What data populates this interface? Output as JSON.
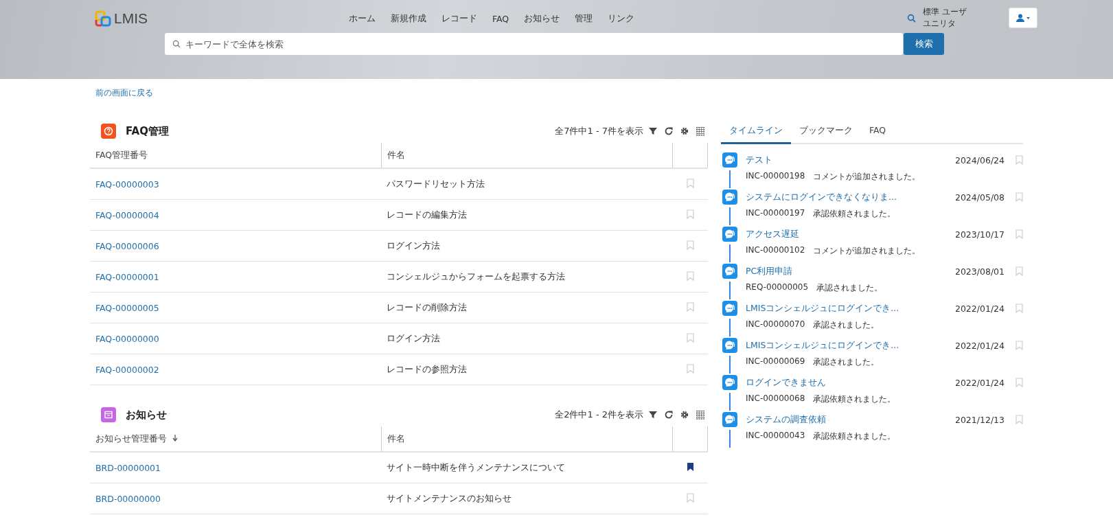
{
  "header": {
    "logo_text": "LMIS",
    "nav": [
      "ホーム",
      "新規作成",
      "レコード",
      "FAQ",
      "お知らせ",
      "管理",
      "リンク"
    ],
    "search": {
      "placeholder": "キーワードで全体を検索",
      "button": "検索"
    },
    "user": {
      "role": "標準 ユーザ",
      "company": "ユニリタ"
    }
  },
  "back_link": "前の画面に戻る",
  "sections": [
    {
      "kind": "faq",
      "color": "#f4511e",
      "title": "FAQ管理",
      "count": "全7件中1 - 7件を表示",
      "columns": [
        {
          "label": "FAQ管理番号",
          "sorted": false
        },
        {
          "label": "件名",
          "sorted": false
        }
      ],
      "rows": [
        {
          "id": "FAQ-00000003",
          "subject": "パスワードリセット方法",
          "bookmarked": false
        },
        {
          "id": "FAQ-00000004",
          "subject": "レコードの編集方法",
          "bookmarked": false
        },
        {
          "id": "FAQ-00000006",
          "subject": "ログイン方法",
          "bookmarked": false
        },
        {
          "id": "FAQ-00000001",
          "subject": "コンシェルジュからフォームを起票する方法",
          "bookmarked": false
        },
        {
          "id": "FAQ-00000005",
          "subject": "レコードの削除方法",
          "bookmarked": false
        },
        {
          "id": "FAQ-00000000",
          "subject": "ログイン方法",
          "bookmarked": false
        },
        {
          "id": "FAQ-00000002",
          "subject": "レコードの参照方法",
          "bookmarked": false
        }
      ]
    },
    {
      "kind": "notice",
      "color": "#c864e8",
      "title": "お知らせ",
      "count": "全2件中1 - 2件を表示",
      "columns": [
        {
          "label": "お知らせ管理番号",
          "sorted": true
        },
        {
          "label": "件名",
          "sorted": false
        }
      ],
      "rows": [
        {
          "id": "BRD-00000001",
          "subject": "サイト一時中断を伴うメンテナンスについて",
          "bookmarked": true
        },
        {
          "id": "BRD-00000000",
          "subject": "サイトメンテナンスのお知らせ",
          "bookmarked": false
        }
      ]
    }
  ],
  "side_tabs": [
    {
      "label": "タイムライン",
      "selected": true
    },
    {
      "label": "ブックマーク",
      "selected": false
    },
    {
      "label": "FAQ",
      "selected": false
    }
  ],
  "timeline": [
    {
      "title": "テスト",
      "date": "2024/06/24",
      "ref": "INC-00000198",
      "message": "コメントが追加されました。",
      "bookmarked": false
    },
    {
      "title": "システムにログインできなくなりま...",
      "date": "2024/05/08",
      "ref": "INC-00000197",
      "message": "承認依頼されました。",
      "bookmarked": false
    },
    {
      "title": "アクセス遅延",
      "date": "2023/10/17",
      "ref": "INC-00000102",
      "message": "コメントが追加されました。",
      "bookmarked": false
    },
    {
      "title": "PC利用申請",
      "date": "2023/08/01",
      "ref": "REQ-00000005",
      "message": "承認されました。",
      "bookmarked": false
    },
    {
      "title": "LMISコンシェルジュにログインでき...",
      "date": "2022/01/24",
      "ref": "INC-00000070",
      "message": "承認されました。",
      "bookmarked": false
    },
    {
      "title": "LMISコンシェルジュにログインでき...",
      "date": "2022/01/24",
      "ref": "INC-00000069",
      "message": "承認されました。",
      "bookmarked": false
    },
    {
      "title": "ログインできません",
      "date": "2022/01/24",
      "ref": "INC-00000068",
      "message": "承認依頼されました。",
      "bookmarked": false
    },
    {
      "title": "システムの調査依頼",
      "date": "2021/12/13",
      "ref": "INC-00000043",
      "message": "承認依頼されました。",
      "bookmarked": false
    }
  ]
}
